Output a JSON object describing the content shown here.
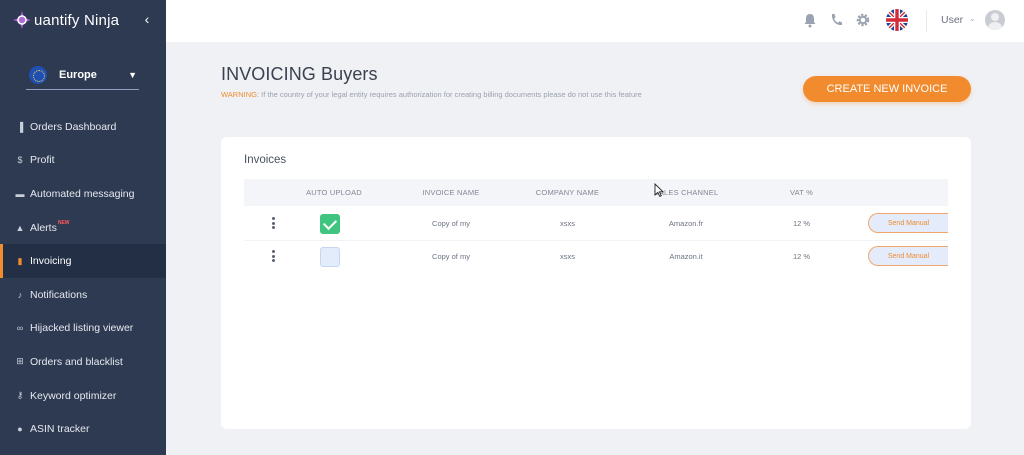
{
  "brand": {
    "name": "uantify Ninja"
  },
  "sidebar": {
    "region": "Europe",
    "items": [
      {
        "label": "Orders Dashboard",
        "icon": "bar-chart-icon",
        "glyph": "▐"
      },
      {
        "label": "Profit",
        "icon": "dollar-icon",
        "glyph": "$"
      },
      {
        "label": "Automated messaging",
        "icon": "message-icon",
        "glyph": "▬"
      },
      {
        "label": "Alerts",
        "icon": "warning-icon",
        "glyph": "▲",
        "badge": "NEW"
      },
      {
        "label": "Invoicing",
        "icon": "invoice-icon",
        "glyph": "▮",
        "active": true
      },
      {
        "label": "Notifications",
        "icon": "bell-icon",
        "glyph": "♪"
      },
      {
        "label": "Hijacked listing viewer",
        "icon": "glasses-icon",
        "glyph": "∞"
      },
      {
        "label": "Orders and blacklist",
        "icon": "cart-icon",
        "glyph": "⊞"
      },
      {
        "label": "Keyword optimizer",
        "icon": "key-icon",
        "glyph": "⚷"
      },
      {
        "label": "ASIN tracker",
        "icon": "info-icon",
        "glyph": "●"
      }
    ]
  },
  "topbar": {
    "user_label": "User"
  },
  "page": {
    "title": "INVOICING Buyers",
    "warning_label": "WARNING",
    "warning_text": ": If the country of your legal entity requires authorization for creating billing documents please do not use this feature",
    "create_button": "CREATE NEW INVOICE"
  },
  "invoices": {
    "title": "Invoices",
    "columns": [
      "AUTO UPLOAD",
      "INVOICE NAME",
      "COMPANY NAME",
      "SALES CHANNEL",
      "VAT %"
    ],
    "rows": [
      {
        "auto_upload": true,
        "invoice_name": "Copy of my",
        "company_name": "xsxs",
        "sales_channel": "Amazon.fr",
        "vat": "12 %",
        "action": "Send Manual"
      },
      {
        "auto_upload": false,
        "invoice_name": "Copy of my",
        "company_name": "xsxs",
        "sales_channel": "Amazon.it",
        "vat": "12 %",
        "action": "Send Manual"
      }
    ]
  },
  "colors": {
    "sidebar_bg": "#2d3a52",
    "accent": "#f28a2e",
    "check_green": "#3fc57f"
  }
}
